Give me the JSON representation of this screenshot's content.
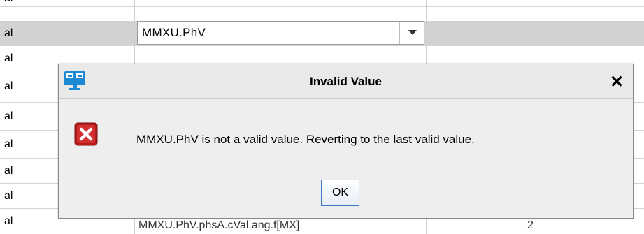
{
  "table": {
    "rows": [
      {
        "col0": "al"
      },
      {
        "col0": "al"
      },
      {
        "col0": "al"
      },
      {
        "col0": "al"
      },
      {
        "col0": "al"
      },
      {
        "col0": "al"
      },
      {
        "col0": "al"
      },
      {
        "col0": "al"
      },
      {
        "col0": "al"
      }
    ],
    "combo_value": "MMXU.PhV",
    "bottom_row_text": "MMXU.PhV.phsA.cVal.ang.f[MX]",
    "bottom_row_number": "2"
  },
  "dialog": {
    "title": "Invalid Value",
    "close_label": "✕",
    "message": "MMXU.PhV is not a valid value. Reverting to the last valid value.",
    "ok_label": "OK"
  },
  "icons": {
    "app": "app-window-icon",
    "error": "error-x-icon",
    "dropdown": "chevron-down-icon"
  },
  "colors": {
    "selected_row": "#d2d2d2",
    "error_red": "#c0221f",
    "app_icon_blue": "#1e8ad6",
    "ok_border": "#3c78c8"
  }
}
